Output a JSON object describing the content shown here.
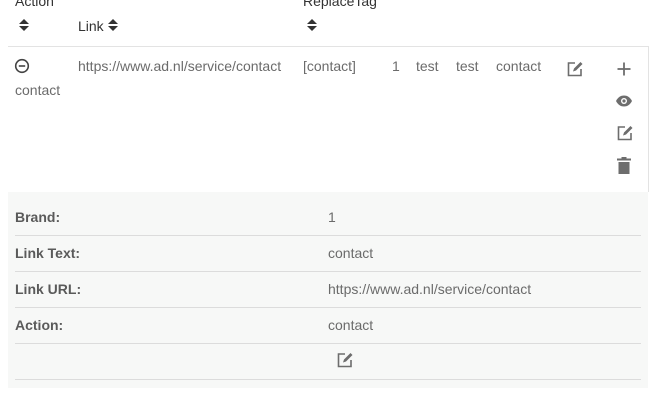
{
  "table": {
    "headers": {
      "action": "Action",
      "link": "Link",
      "replace_tag": "ReplaceTag"
    },
    "row": {
      "action": "contact",
      "link": "https://www.ad.nl/service/contact",
      "replace_tag": "[contact]",
      "brand": "1",
      "col5": "test",
      "col6": "test",
      "link_text": "contact"
    }
  },
  "details": {
    "items": [
      {
        "label": "Brand:",
        "value": "1"
      },
      {
        "label": "Link Text:",
        "value": "contact"
      },
      {
        "label": "Link URL:",
        "value": "https://www.ad.nl/service/contact"
      },
      {
        "label": "Action:",
        "value": "contact"
      }
    ]
  },
  "icons": {
    "collapse": "minus-circle-icon",
    "edit": "edit-icon",
    "add": "plus-icon",
    "view": "eye-icon",
    "delete": "trash-icon"
  },
  "colors": {
    "icon": "#6d6d6d",
    "detail_bg": "#f7f8f7",
    "divider": "#e3e3e3"
  }
}
